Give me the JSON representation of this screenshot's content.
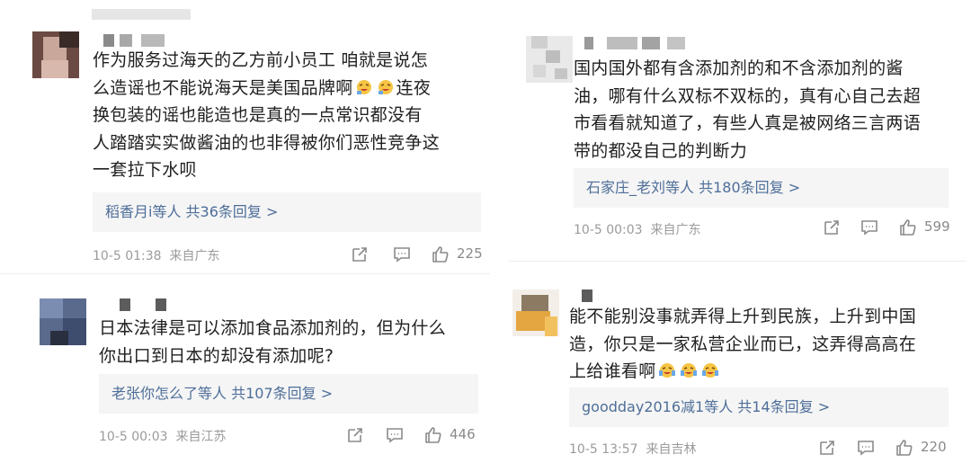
{
  "comments": [
    {
      "text": "作为服务过海天的乙方前小员工 咱就是说怎么造谣也不能说海天是美国品牌啊  连夜换包装的谣也能造也是真的一点常识都没有人踏踏实实做酱油的也非得被你们恶性竞争这一套拉下水呗",
      "lines": [
        "作为服务过海天的乙方前小员工 咱就是说怎",
        "么造谣也不能说海天是美国品牌啊",
        "换包装的谣也能造也是真的一点常识都没有",
        "人踏踏实实做酱油的也非得被你们恶性竞争这",
        "一套拉下水呗"
      ],
      "line2_tail": "连夜",
      "replies": "稻香月i等人  共36条回复 >",
      "time": "10-5 01:38",
      "location": "来自广东",
      "likes": "225"
    },
    {
      "text": "日本法律是可以添加食品添加剂的，但为什么你出口到日本的却没有添加呢？",
      "lines": [
        "日本法律是可以添加食品添加剂的，但为什么",
        "你出口到日本的却没有添加呢?"
      ],
      "replies": "老张你怎么了等人  共107条回复 >",
      "time": "10-5 00:03",
      "location": "来自江苏",
      "likes": "446"
    },
    {
      "text": "国内国外都有含添加剂的和不含添加剂的酱油，哪有什么双标不双标的，真有心自己去超市看看就知道了，有些人真是被网络三言两语带的都没自己的判断力",
      "lines": [
        "国内国外都有含添加剂的和不含添加剂的酱",
        "油，哪有什么双标不双标的，真有心自己去超",
        "市看看就知道了，有些人真是被网络三言两语",
        "带的都没自己的判断力"
      ],
      "replies": "石家庄_老刘等人  共180条回复 >",
      "time": "10-5 00:03",
      "location": "来自广东",
      "likes": "599"
    },
    {
      "text": "能不能别没事就弄得上升到民族，上升到中国造，你只是一家私营企业而已，这弄得高高在上给谁看啊",
      "lines": [
        "能不能别没事就弄得上升到民族，上升到中国",
        "造，你只是一家私营企业而已，这弄得高高在",
        "上给谁看啊"
      ],
      "replies": "goodday2016减1等人  共14条回复 >",
      "time": "10-5 13:57",
      "location": "来自吉林",
      "likes": "220"
    }
  ],
  "icons": {
    "share": "share-icon",
    "comment": "comment-icon",
    "like": "thumbs-up-icon",
    "emoji": "laughing-emoji"
  },
  "colors": {
    "reply_link": "#4e6e99",
    "meta": "#9b9b9b",
    "reply_bg": "#f5f5f5"
  }
}
